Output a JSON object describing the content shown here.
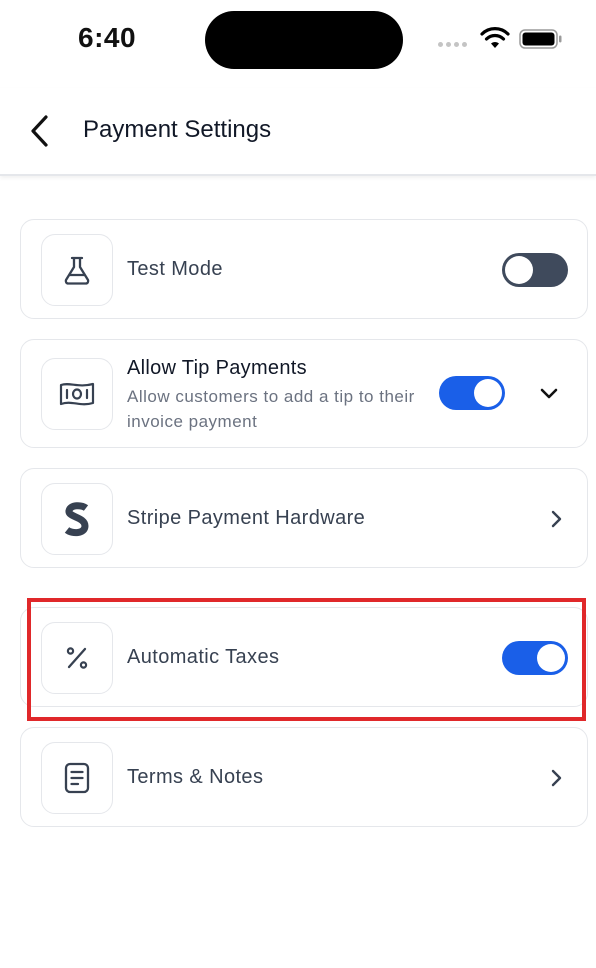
{
  "status_bar": {
    "time": "6:40"
  },
  "header": {
    "title": "Payment Settings"
  },
  "rows": [
    {
      "label": "Test Mode",
      "icon": "flask-icon",
      "toggle": false
    },
    {
      "label": "Allow Tip Payments",
      "description": "Allow customers to add a tip to their invoice payment",
      "icon": "banknote-icon",
      "toggle": true,
      "expandable": true
    },
    {
      "label": "Stripe Payment Hardware",
      "icon": "stripe-logo"
    },
    {
      "label": "Automatic Taxes",
      "icon": "percent-icon",
      "toggle": true,
      "highlighted": true
    },
    {
      "label": "Terms & Notes",
      "icon": "document-icon"
    }
  ],
  "colors": {
    "toggle_on": "#1a5fe8",
    "toggle_off": "#3f4a5c",
    "highlight": "#e0282a"
  }
}
